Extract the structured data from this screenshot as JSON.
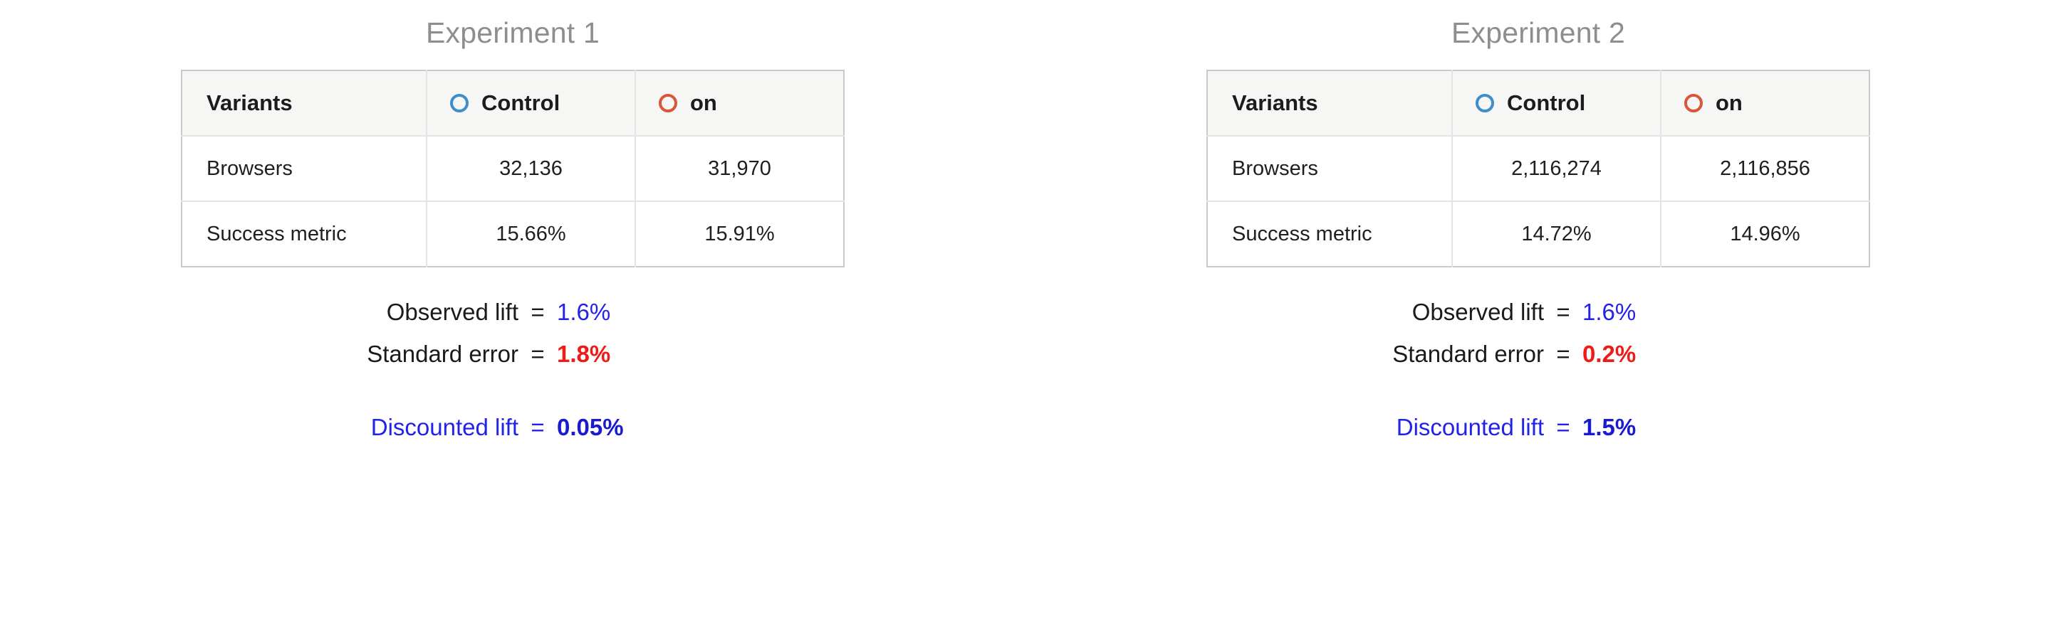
{
  "theme": {
    "title_color": "#8e8e8e",
    "table_border": "#c9c9c9",
    "table_header_bg": "#f6f6f5",
    "control_ring_color": "#3d8ec9",
    "variant_ring_color": "#d9563a",
    "blue_value": "#2222e8",
    "red_value": "#ef1b17",
    "discount_blue": "#1a1ad0"
  },
  "experiments": [
    {
      "title": "Experiment 1",
      "table": {
        "columns": [
          {
            "label": "Variants",
            "icon": null
          },
          {
            "label": "Control",
            "icon": "circle-outline-icon"
          },
          {
            "label": "on",
            "icon": "circle-outline-icon"
          }
        ],
        "rows": [
          {
            "label": "Browsers",
            "control": "32,136",
            "variant": "31,970"
          },
          {
            "label": "Success metric",
            "control": "15.66%",
            "variant": "15.91%"
          }
        ]
      },
      "stats": {
        "observed_lift": {
          "label": "Observed lift",
          "eq": "=",
          "value": "1.6%"
        },
        "standard_error": {
          "label": "Standard error",
          "eq": "=",
          "value": "1.8%"
        },
        "discounted_lift": {
          "label": "Discounted lift",
          "eq": "=",
          "value": "0.05%"
        }
      }
    },
    {
      "title": "Experiment 2",
      "table": {
        "columns": [
          {
            "label": "Variants",
            "icon": null
          },
          {
            "label": "Control",
            "icon": "circle-outline-icon"
          },
          {
            "label": "on",
            "icon": "circle-outline-icon"
          }
        ],
        "rows": [
          {
            "label": "Browsers",
            "control": "2,116,274",
            "variant": "2,116,856"
          },
          {
            "label": "Success metric",
            "control": "14.72%",
            "variant": "14.96%"
          }
        ]
      },
      "stats": {
        "observed_lift": {
          "label": "Observed lift",
          "eq": "=",
          "value": "1.6%"
        },
        "standard_error": {
          "label": "Standard error",
          "eq": "=",
          "value": "0.2%"
        },
        "discounted_lift": {
          "label": "Discounted lift",
          "eq": "=",
          "value": "1.5%"
        }
      }
    }
  ]
}
